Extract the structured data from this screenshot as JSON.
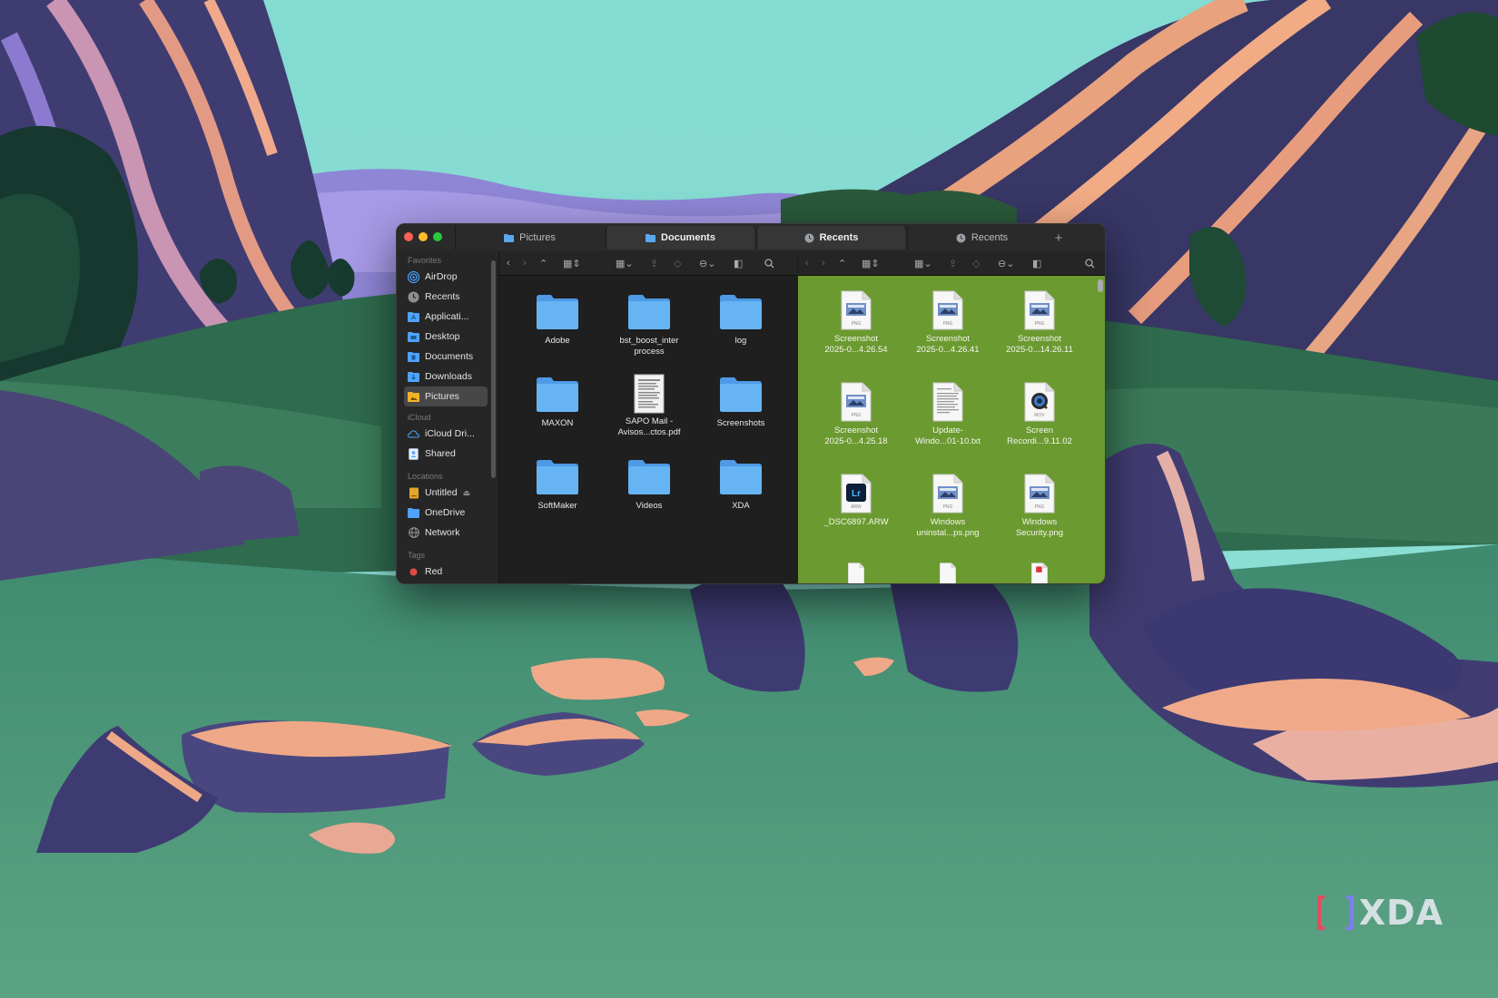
{
  "window": {
    "tabs": [
      {
        "label": "Pictures",
        "icon": "folder-icon"
      },
      {
        "label": "Documents",
        "icon": "folder-icon"
      },
      {
        "label": "Recents",
        "icon": "clock-icon"
      },
      {
        "label": "Recents",
        "icon": "clock-icon"
      }
    ],
    "new_tab_label": "+"
  },
  "sidebar": {
    "favorites_header": "Favorites",
    "favorites": [
      {
        "label": "AirDrop",
        "icon": "airdrop-icon"
      },
      {
        "label": "Recents",
        "icon": "clock-icon"
      },
      {
        "label": "Applicati...",
        "icon": "applications-icon"
      },
      {
        "label": "Desktop",
        "icon": "desktop-folder-icon"
      },
      {
        "label": "Documents",
        "icon": "documents-folder-icon"
      },
      {
        "label": "Downloads",
        "icon": "downloads-folder-icon"
      },
      {
        "label": "Pictures",
        "icon": "pictures-folder-icon",
        "selected": true
      }
    ],
    "icloud_header": "iCloud",
    "icloud": [
      {
        "label": "iCloud Dri...",
        "icon": "cloud-icon"
      },
      {
        "label": "Shared",
        "icon": "shared-folder-icon"
      }
    ],
    "locations_header": "Locations",
    "locations": [
      {
        "label": "Untitled",
        "icon": "drive-icon",
        "eject": "⏏"
      },
      {
        "label": "OneDrive",
        "icon": "folder-icon"
      },
      {
        "label": "Network",
        "icon": "network-icon"
      }
    ],
    "tags_header": "Tags",
    "tags": [
      {
        "label": "Red",
        "color": "#e5493f"
      }
    ]
  },
  "left_pane": {
    "items": [
      {
        "label": "Adobe",
        "type": "folder"
      },
      {
        "label": "bst_boost_inter",
        "label2": "process",
        "type": "folder"
      },
      {
        "label": "log",
        "type": "folder"
      },
      {
        "label": "MAXON",
        "type": "folder"
      },
      {
        "label": "SAPO Mail -",
        "label2": "Avisos...ctos.pdf",
        "type": "pdf"
      },
      {
        "label": "Screenshots",
        "type": "folder"
      },
      {
        "label": "SoftMaker",
        "type": "folder"
      },
      {
        "label": "Videos",
        "type": "folder"
      },
      {
        "label": "XDA",
        "type": "folder"
      }
    ]
  },
  "right_pane": {
    "background": "#6b9a31",
    "items": [
      {
        "label": "Screenshot",
        "label2": "2025-0...4.26.54",
        "type": "png",
        "badge": "PNG"
      },
      {
        "label": "Screenshot",
        "label2": "2025-0...4.26.41",
        "type": "png",
        "badge": "PNG"
      },
      {
        "label": "Screenshot",
        "label2": "2025-0...14.26.11",
        "type": "png",
        "badge": "PNG"
      },
      {
        "label": "Screenshot",
        "label2": "2025-0...4.25.18",
        "type": "png",
        "badge": "PNG"
      },
      {
        "label": "Update-",
        "label2": "Windo...01-10.txt",
        "type": "txt",
        "badge": ""
      },
      {
        "label": "Screen",
        "label2": "Recordi...9.11.02",
        "type": "mov",
        "badge": "MOV"
      },
      {
        "label": "_DSC6897.ARW",
        "label2": "",
        "type": "arw",
        "badge": "ARW",
        "app_badge": "Lr"
      },
      {
        "label": "Windows",
        "label2": "uninstal...ps.png",
        "type": "png",
        "badge": "PNG"
      },
      {
        "label": "Windows",
        "label2": "Security.png",
        "type": "png",
        "badge": "PNG"
      }
    ]
  },
  "watermark": {
    "text": "XDA"
  },
  "colors": {
    "folder": "#5aa9ee",
    "accent_green": "#6b9a31",
    "traffic_red": "#fe5f57",
    "traffic_yellow": "#febc2e",
    "traffic_green": "#28c840"
  }
}
